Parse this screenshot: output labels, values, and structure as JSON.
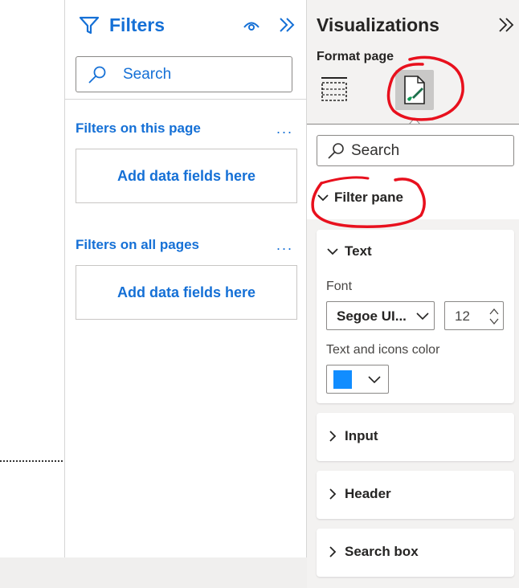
{
  "filters_pane": {
    "title": "Filters",
    "search_placeholder": "Search",
    "sections": [
      {
        "title": "Filters on this page",
        "more": "...",
        "drop_label": "Add data fields here"
      },
      {
        "title": "Filters on all pages",
        "more": "...",
        "drop_label": "Add data fields here"
      }
    ]
  },
  "viz_pane": {
    "title": "Visualizations",
    "subtitle": "Format page",
    "search_placeholder": "Search",
    "filter_pane_header": "Filter pane",
    "text_card": {
      "title": "Text",
      "font_label": "Font",
      "font_value": "Segoe UI...",
      "size_value": "12",
      "color_label": "Text and icons color",
      "color_value": "#118DFF"
    },
    "collapsed_cards": [
      {
        "title": "Input"
      },
      {
        "title": "Header"
      },
      {
        "title": "Search box"
      }
    ]
  },
  "colors": {
    "accent_blue": "#1570D6",
    "annotation_red": "#E8101D"
  }
}
